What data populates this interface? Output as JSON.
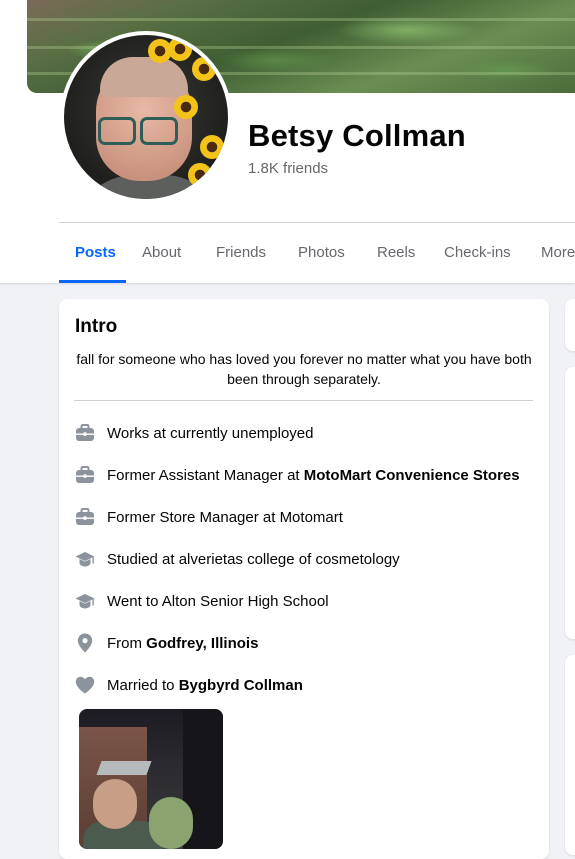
{
  "profile": {
    "name": "Betsy Collman",
    "friends": "1.8K friends"
  },
  "tabs": [
    {
      "label": "Posts",
      "active": true
    },
    {
      "label": "About"
    },
    {
      "label": "Friends"
    },
    {
      "label": "Photos"
    },
    {
      "label": "Reels"
    },
    {
      "label": "Check-ins"
    },
    {
      "label": "More"
    }
  ],
  "intro": {
    "title": "Intro",
    "bio": "fall for someone who has loved you forever no matter what you have both been through separately.",
    "items": [
      {
        "icon": "briefcase-icon",
        "text": "Works at currently unemployed",
        "bold": ""
      },
      {
        "icon": "briefcase-icon",
        "text": "Former Assistant Manager at ",
        "bold": "MotoMart Convenience Stores"
      },
      {
        "icon": "briefcase-icon",
        "text": "Former Store Manager at Motomart",
        "bold": ""
      },
      {
        "icon": "graduation-cap-icon",
        "text": "Studied at alverietas college of cosmetology",
        "bold": ""
      },
      {
        "icon": "graduation-cap-icon",
        "text": "Went to Alton Senior High School",
        "bold": ""
      },
      {
        "icon": "location-pin-icon",
        "text": "From ",
        "bold": "Godfrey, Illinois"
      },
      {
        "icon": "heart-icon",
        "text": "Married to ",
        "bold": "Bygbyrd Collman"
      }
    ]
  },
  "colors": {
    "accent": "#0866ff",
    "secondary_text": "#65676b",
    "icon_gray": "#8c939d",
    "background": "#f0f2f5"
  }
}
